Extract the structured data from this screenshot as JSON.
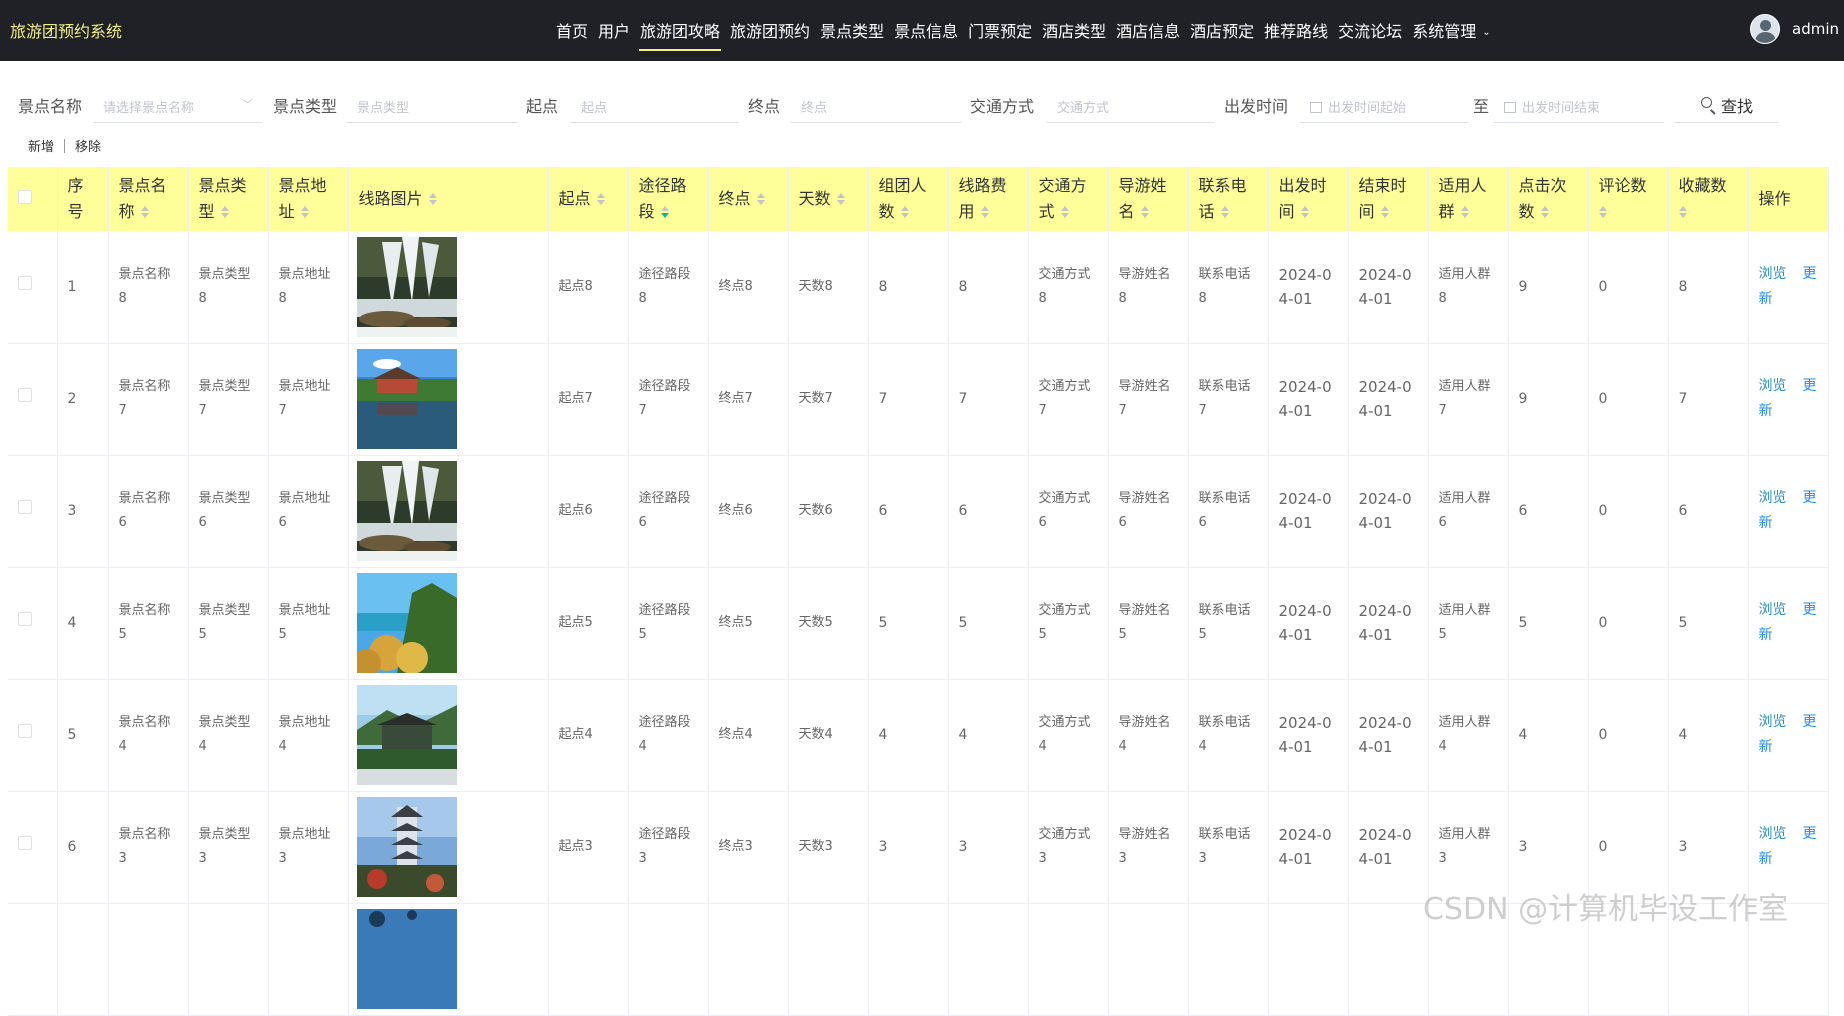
{
  "app": {
    "title": "旅游团预约系统"
  },
  "nav": {
    "items": [
      "首页",
      "用户",
      "旅游团攻略",
      "旅游团预约",
      "景点类型",
      "景点信息",
      "门票预定",
      "酒店类型",
      "酒店信息",
      "酒店预定",
      "推荐路线",
      "交流论坛",
      "系统管理"
    ],
    "active": "旅游团攻略"
  },
  "user": {
    "name": "admin"
  },
  "search": {
    "spot_name_label": "景点名称",
    "spot_name_placeholder": "请选择景点名称",
    "spot_type_label": "景点类型",
    "spot_type_placeholder": "景点类型",
    "start_label": "起点",
    "start_placeholder": "起点",
    "end_label": "终点",
    "end_placeholder": "终点",
    "transport_label": "交通方式",
    "transport_placeholder": "交通方式",
    "depart_label": "出发时间",
    "depart_start_placeholder": "出发时间起始",
    "to_label": "至",
    "depart_end_placeholder": "出发时间结束",
    "find_button": "查找"
  },
  "toolbar": {
    "add": "新增",
    "remove": "移除"
  },
  "table": {
    "headers": {
      "index": "序号",
      "name": "景点名称",
      "type": "景点类型",
      "addr": "景点地址",
      "img": "线路图片",
      "start": "起点",
      "route": "途径路段",
      "end": "终点",
      "days": "天数",
      "people": "组团人数",
      "cost": "线路费用",
      "transport": "交通方式",
      "guide": "导游姓名",
      "phone": "联系电话",
      "depart": "出发时间",
      "finish": "结束时间",
      "audience": "适用人群",
      "clicks": "点击次数",
      "comments": "评论数",
      "favs": "收藏数",
      "ops": "操作"
    },
    "row_actions": {
      "view": "浏览",
      "update": "更新"
    },
    "rows": [
      {
        "index": "1",
        "name": "景点名称8",
        "type": "景点类型8",
        "addr": "景点地址8",
        "img": "waterfall",
        "start": "起点8",
        "route": "途径路段8",
        "end": "终点8",
        "days": "天数8",
        "people": "8",
        "cost": "8",
        "transport": "交通方式8",
        "guide": "导游姓名8",
        "phone": "联系电话8",
        "depart": "2024-04-01",
        "finish": "2024-04-01",
        "audience": "适用人群8",
        "clicks": "9",
        "comments": "0",
        "favs": "8"
      },
      {
        "index": "2",
        "name": "景点名称7",
        "type": "景点类型7",
        "addr": "景点地址7",
        "img": "lake-pavilion",
        "start": "起点7",
        "route": "途径路段7",
        "end": "终点7",
        "days": "天数7",
        "people": "7",
        "cost": "7",
        "transport": "交通方式7",
        "guide": "导游姓名7",
        "phone": "联系电话7",
        "depart": "2024-04-01",
        "finish": "2024-04-01",
        "audience": "适用人群7",
        "clicks": "9",
        "comments": "0",
        "favs": "7"
      },
      {
        "index": "3",
        "name": "景点名称6",
        "type": "景点类型6",
        "addr": "景点地址6",
        "img": "waterfall",
        "start": "起点6",
        "route": "途径路段6",
        "end": "终点6",
        "days": "天数6",
        "people": "6",
        "cost": "6",
        "transport": "交通方式6",
        "guide": "导游姓名6",
        "phone": "联系电话6",
        "depart": "2024-04-01",
        "finish": "2024-04-01",
        "audience": "适用人群6",
        "clicks": "6",
        "comments": "0",
        "favs": "6"
      },
      {
        "index": "4",
        "name": "景点名称5",
        "type": "景点类型5",
        "addr": "景点地址5",
        "img": "sea-cliff",
        "start": "起点5",
        "route": "途径路段5",
        "end": "终点5",
        "days": "天数5",
        "people": "5",
        "cost": "5",
        "transport": "交通方式5",
        "guide": "导游姓名5",
        "phone": "联系电话5",
        "depart": "2024-04-01",
        "finish": "2024-04-01",
        "audience": "适用人群5",
        "clicks": "5",
        "comments": "0",
        "favs": "5"
      },
      {
        "index": "5",
        "name": "景点名称4",
        "type": "景点类型4",
        "addr": "景点地址4",
        "img": "temple-mountain",
        "start": "起点4",
        "route": "途径路段4",
        "end": "终点4",
        "days": "天数4",
        "people": "4",
        "cost": "4",
        "transport": "交通方式4",
        "guide": "导游姓名4",
        "phone": "联系电话4",
        "depart": "2024-04-01",
        "finish": "2024-04-01",
        "audience": "适用人群4",
        "clicks": "4",
        "comments": "0",
        "favs": "4"
      },
      {
        "index": "6",
        "name": "景点名称3",
        "type": "景点类型3",
        "addr": "景点地址3",
        "img": "pagoda",
        "start": "起点3",
        "route": "途径路段3",
        "end": "终点3",
        "days": "天数3",
        "people": "3",
        "cost": "3",
        "transport": "交通方式3",
        "guide": "导游姓名3",
        "phone": "联系电话3",
        "depart": "2024-04-01",
        "finish": "2024-04-01",
        "audience": "适用人群3",
        "clicks": "3",
        "comments": "0",
        "favs": "3"
      },
      {
        "index": "",
        "name": "",
        "type": "",
        "addr": "",
        "img": "sky-partial",
        "start": "",
        "route": "",
        "end": "",
        "days": "",
        "people": "",
        "cost": "",
        "transport": "",
        "guide": "",
        "phone": "",
        "depart": "",
        "finish": "",
        "audience": "",
        "clicks": "",
        "comments": "",
        "favs": ""
      }
    ]
  },
  "watermark": "CSDN @计算机毕设工作室"
}
